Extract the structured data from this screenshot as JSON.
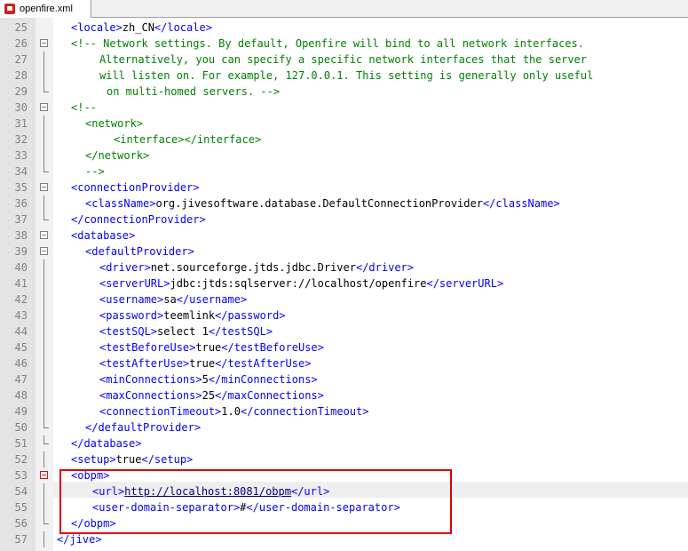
{
  "tab": {
    "title": "openfire.xml"
  },
  "lines": [
    {
      "n": "25",
      "parts": [
        [
          "tag",
          "<locale>"
        ],
        [
          "val",
          "zh_CN"
        ],
        [
          "tag",
          "</locale>"
        ]
      ],
      "indent": 2
    },
    {
      "n": "26",
      "parts": [
        [
          "cmt",
          "<!-- Network settings. By default, Openfire will bind to all network interfaces."
        ]
      ],
      "indent": 2
    },
    {
      "n": "27",
      "parts": [
        [
          "cmt",
          "Alternatively, you can specify a specific network interfaces that the server"
        ]
      ],
      "indent": 6
    },
    {
      "n": "28",
      "parts": [
        [
          "cmt",
          "will listen on. For example, 127.0.0.1. This setting is generally only useful"
        ]
      ],
      "indent": 6
    },
    {
      "n": "29",
      "parts": [
        [
          "cmt",
          "on multi-homed servers. -->"
        ]
      ],
      "indent": 7
    },
    {
      "n": "30",
      "parts": [
        [
          "cmt",
          "<!--"
        ]
      ],
      "indent": 2
    },
    {
      "n": "31",
      "parts": [
        [
          "cmt",
          "<network>"
        ]
      ],
      "indent": 4
    },
    {
      "n": "32",
      "parts": [
        [
          "cmt",
          "<interface></interface>"
        ]
      ],
      "indent": 8
    },
    {
      "n": "33",
      "parts": [
        [
          "cmt",
          "</network>"
        ]
      ],
      "indent": 4
    },
    {
      "n": "34",
      "parts": [
        [
          "cmt",
          "-->"
        ]
      ],
      "indent": 4
    },
    {
      "n": "35",
      "parts": [
        [
          "tag",
          "<connectionProvider>"
        ]
      ],
      "indent": 2
    },
    {
      "n": "36",
      "parts": [
        [
          "tag",
          "<className>"
        ],
        [
          "val",
          "org.jivesoftware.database.DefaultConnectionProvider"
        ],
        [
          "tag",
          "</className>"
        ]
      ],
      "indent": 4
    },
    {
      "n": "37",
      "parts": [
        [
          "tag",
          "</connectionProvider>"
        ]
      ],
      "indent": 2
    },
    {
      "n": "38",
      "parts": [
        [
          "tag",
          "<database>"
        ]
      ],
      "indent": 2
    },
    {
      "n": "39",
      "parts": [
        [
          "tag",
          "<defaultProvider>"
        ]
      ],
      "indent": 4
    },
    {
      "n": "40",
      "parts": [
        [
          "tag",
          "<driver>"
        ],
        [
          "val",
          "net.sourceforge.jtds.jdbc.Driver"
        ],
        [
          "tag",
          "</driver>"
        ]
      ],
      "indent": 6
    },
    {
      "n": "41",
      "parts": [
        [
          "tag",
          "<serverURL>"
        ],
        [
          "val",
          "jdbc:jtds:sqlserver://localhost/openfire"
        ],
        [
          "tag",
          "</serverURL>"
        ]
      ],
      "indent": 6
    },
    {
      "n": "42",
      "parts": [
        [
          "tag",
          "<username>"
        ],
        [
          "val",
          "sa"
        ],
        [
          "tag",
          "</username>"
        ]
      ],
      "indent": 6
    },
    {
      "n": "43",
      "parts": [
        [
          "tag",
          "<password>"
        ],
        [
          "val",
          "teemlink"
        ],
        [
          "tag",
          "</password>"
        ]
      ],
      "indent": 6
    },
    {
      "n": "44",
      "parts": [
        [
          "tag",
          "<testSQL>"
        ],
        [
          "val",
          "select 1"
        ],
        [
          "tag",
          "</testSQL>"
        ]
      ],
      "indent": 6
    },
    {
      "n": "45",
      "parts": [
        [
          "tag",
          "<testBeforeUse>"
        ],
        [
          "val",
          "true"
        ],
        [
          "tag",
          "</testBeforeUse>"
        ]
      ],
      "indent": 6
    },
    {
      "n": "46",
      "parts": [
        [
          "tag",
          "<testAfterUse>"
        ],
        [
          "val",
          "true"
        ],
        [
          "tag",
          "</testAfterUse>"
        ]
      ],
      "indent": 6
    },
    {
      "n": "47",
      "parts": [
        [
          "tag",
          "<minConnections>"
        ],
        [
          "val",
          "5"
        ],
        [
          "tag",
          "</minConnections>"
        ]
      ],
      "indent": 6
    },
    {
      "n": "48",
      "parts": [
        [
          "tag",
          "<maxConnections>"
        ],
        [
          "val",
          "25"
        ],
        [
          "tag",
          "</maxConnections>"
        ]
      ],
      "indent": 6
    },
    {
      "n": "49",
      "parts": [
        [
          "tag",
          "<connectionTimeout>"
        ],
        [
          "val",
          "1.0"
        ],
        [
          "tag",
          "</connectionTimeout>"
        ]
      ],
      "indent": 6
    },
    {
      "n": "50",
      "parts": [
        [
          "tag",
          "</defaultProvider>"
        ]
      ],
      "indent": 4
    },
    {
      "n": "51",
      "parts": [
        [
          "tag",
          "</database>"
        ]
      ],
      "indent": 2
    },
    {
      "n": "52",
      "parts": [
        [
          "tag",
          "<setup>"
        ],
        [
          "val",
          "true"
        ],
        [
          "tag",
          "</setup>"
        ]
      ],
      "indent": 2
    },
    {
      "n": "53",
      "parts": [
        [
          "tag",
          "<obpm>"
        ]
      ],
      "indent": 2
    },
    {
      "n": "54",
      "parts": [
        [
          "tag",
          "<url>"
        ],
        [
          "url",
          "http://localhost:8081/obpm"
        ],
        [
          "tag",
          "</url>"
        ]
      ],
      "indent": 5
    },
    {
      "n": "55",
      "parts": [
        [
          "tag",
          "<user-domain-separator>"
        ],
        [
          "val",
          "#"
        ],
        [
          "tag",
          "</user-domain-separator>"
        ]
      ],
      "indent": 5
    },
    {
      "n": "56",
      "parts": [
        [
          "tag",
          "</obpm>"
        ]
      ],
      "indent": 2
    },
    {
      "n": "57",
      "parts": [
        [
          "tag",
          "</jive>"
        ]
      ],
      "indent": 0
    }
  ],
  "colors": {
    "tag": "#0000ff",
    "comment": "#008000",
    "highlight": "#e00000"
  }
}
